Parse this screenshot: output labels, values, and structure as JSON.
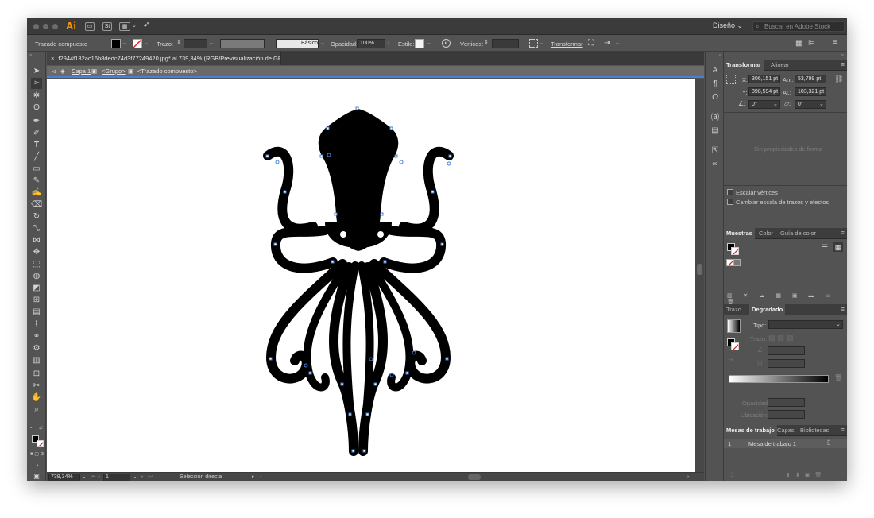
{
  "titlebar": {
    "app_logo": "Ai",
    "stock_icon": "St",
    "workspace": "Diseño",
    "search_placeholder": "Buscar en Adobe Stock"
  },
  "controlbar": {
    "selection_label": "Trazado compuesto",
    "stroke_label": "Trazo:",
    "brush_label": "Básico",
    "opacity_label": "Opacidad:",
    "opacity_value": "100%",
    "style_label": "Estilo:",
    "vertices_label": "Vértices:",
    "transform_label": "Transformar"
  },
  "document": {
    "tab_title": "f2944f132ac16b8dedc74d3f77249420.jpg* al 739,34% (RGB/Previsualización de GPU)",
    "close_glyph": "×",
    "breadcrumb": [
      "Capa 1",
      "<Grupo>",
      "<Trazado compuesto>"
    ],
    "zoom": "739,34%",
    "artboard_number": "1",
    "status_tool": "Selección directa"
  },
  "transform_panel": {
    "tabs": [
      "Transformar",
      "Alinear"
    ],
    "x_label": "X:",
    "x_value": "306,151 pt",
    "y_label": "Y:",
    "y_value": "398,594 pt",
    "w_label": "An.:",
    "w_value": "53,799 pt",
    "h_label": "Al.:",
    "h_value": "103,321 pt",
    "rotate_value": "0°",
    "shear_value": "0°",
    "no_shape_text": "Sin propiedades de forma",
    "scale_corners_label": "Escalar vértices",
    "scale_strokes_label": "Cambiar escala de trazos y efectos"
  },
  "swatches_panel": {
    "tabs": [
      "Muestras",
      "Color",
      "Guía de color"
    ]
  },
  "gradient_panel": {
    "tabs": [
      "Trazo",
      "Degradado"
    ],
    "type_label": "Tipo:",
    "stroke_label": "Trazo:",
    "opacity_label": "Opacidad:",
    "location_label": "Ubicación:"
  },
  "artboards_panel": {
    "tabs": [
      "Mesas de trabajo",
      "Capas",
      "Bibliotecas"
    ],
    "rows": [
      {
        "number": "1",
        "name": "Mesa de trabajo 1"
      }
    ]
  },
  "colors": {
    "chrome_dark": "#3b3b3b",
    "panel": "#535353",
    "isolation_bar": "#6a6a6a",
    "selection_blue": "#4a7fd3",
    "logo_orange": "#ff9a00",
    "artwork": "#000000"
  }
}
